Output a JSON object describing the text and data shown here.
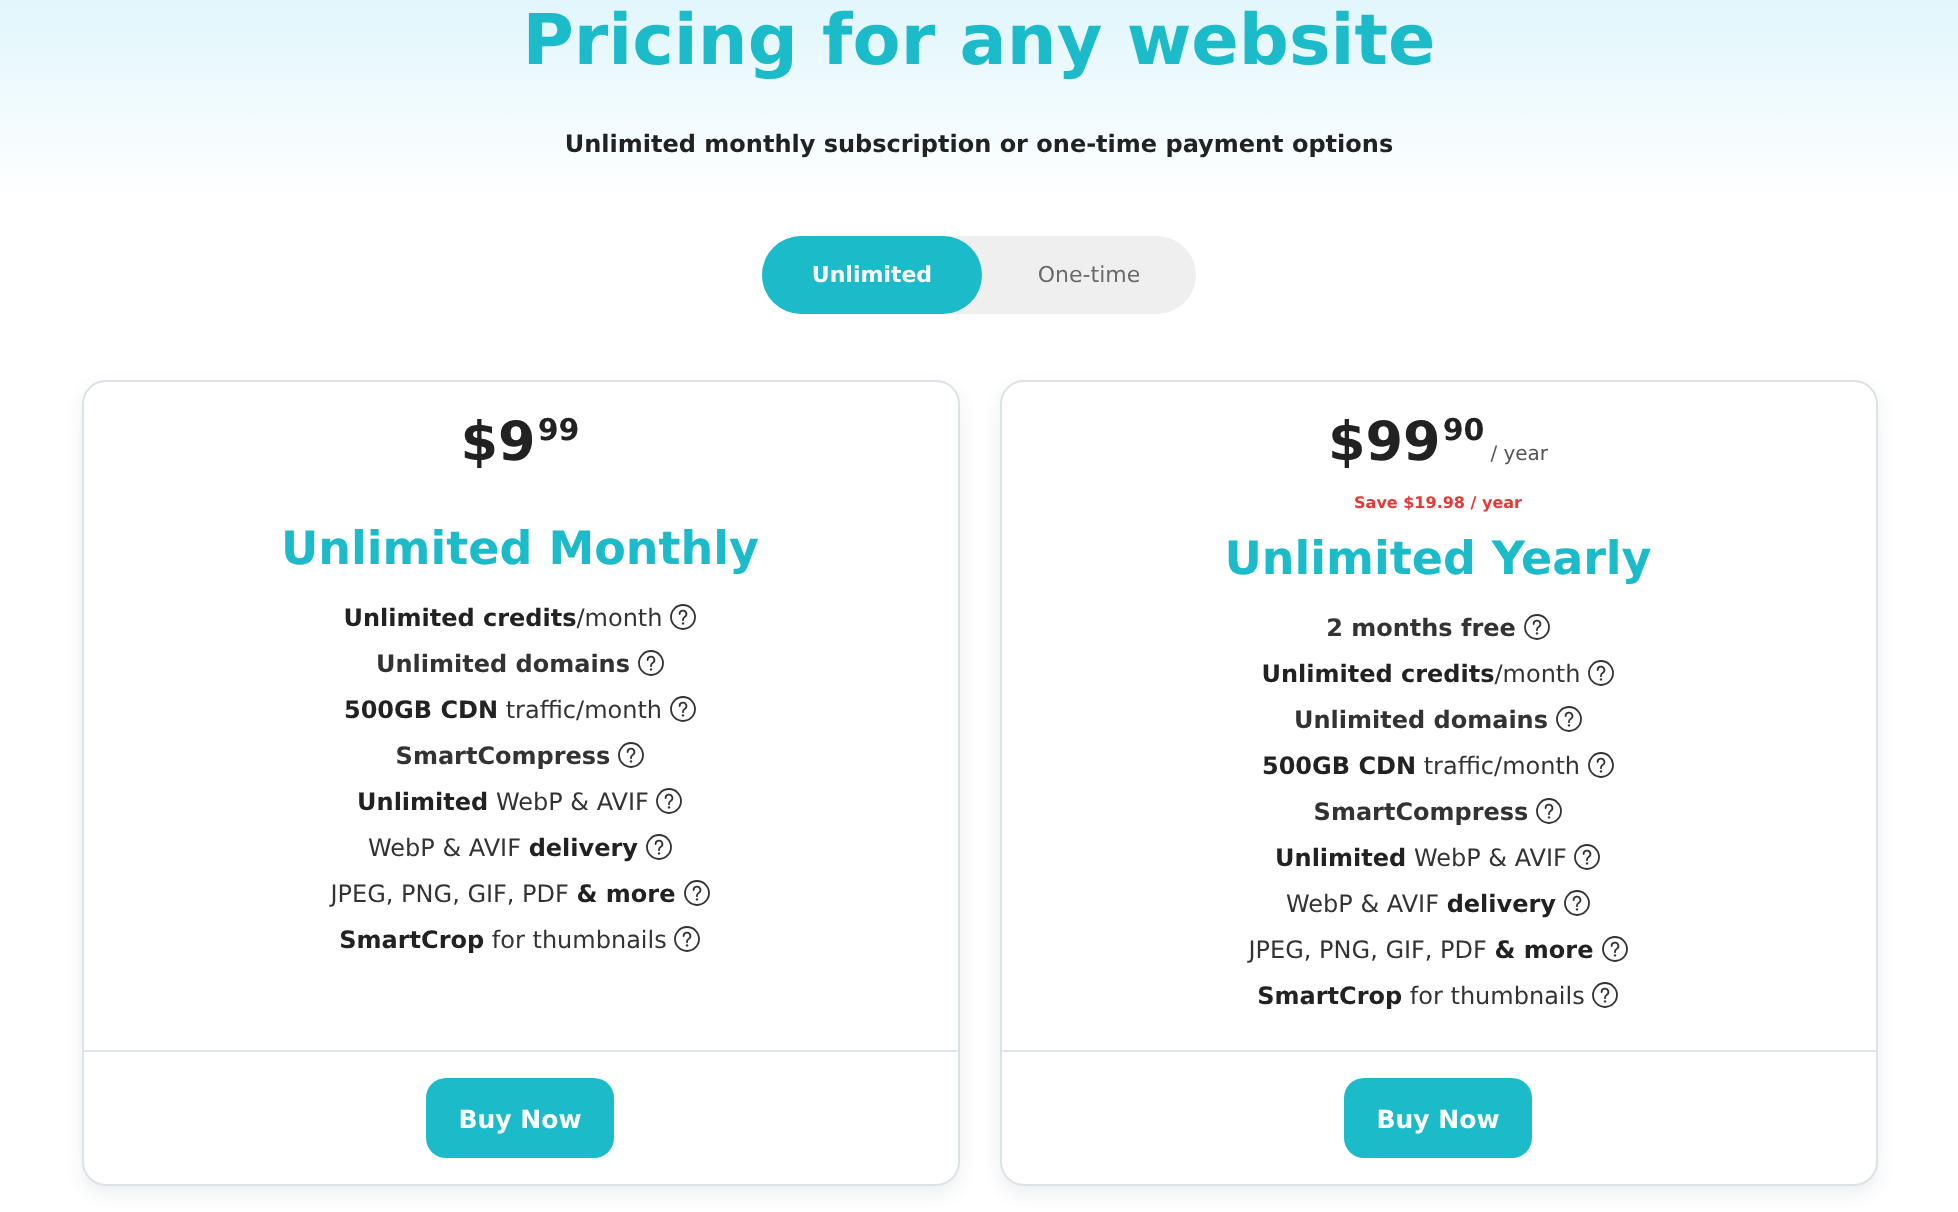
{
  "header": {
    "title": "Pricing for any website",
    "subtitle": "Unlimited monthly subscription or one-time payment options"
  },
  "billing_toggle": [
    {
      "label": "Unlimited",
      "selected": true
    },
    {
      "label": "One-time",
      "selected": false
    }
  ],
  "plans": [
    {
      "amount": "$9",
      "cents": "99",
      "title": "Unlimited Monthly",
      "features": [
        {
          "text": "**Unlimited credits**/month",
          "bold": false
        },
        {
          "text": "Unlimited domains",
          "bold": true
        },
        {
          "text": "**500GB CDN** traffic/month",
          "bold": false
        },
        {
          "text": "SmartCompress",
          "bold": true
        },
        {
          "text": "**Unlimited** WebP & AVIF",
          "bold": false
        },
        {
          "text": "WebP & AVIF **delivery**",
          "bold": false
        },
        {
          "text": "JPEG, PNG, GIF, PDF **& more**",
          "bold": false
        },
        {
          "text": "**SmartCrop** for thumbnails",
          "bold": false
        }
      ],
      "button": "Buy Now"
    },
    {
      "amount": "$99",
      "cents": "90",
      "period": "/ year",
      "savings": "Save $19.98 / year",
      "title": "Unlimited Yearly",
      "features": [
        {
          "text": "2 months free",
          "bold": true
        },
        {
          "text": "**Unlimited credits**/month",
          "bold": false
        },
        {
          "text": "Unlimited domains",
          "bold": true
        },
        {
          "text": "**500GB CDN** traffic/month",
          "bold": false
        },
        {
          "text": "SmartCompress",
          "bold": true
        },
        {
          "text": "**Unlimited** WebP & AVIF",
          "bold": false
        },
        {
          "text": "WebP & AVIF **delivery**",
          "bold": false
        },
        {
          "text": "JPEG, PNG, GIF, PDF **& more**",
          "bold": false
        },
        {
          "text": "**SmartCrop** for thumbnails",
          "bold": false
        }
      ],
      "button": "Buy Now"
    }
  ]
}
